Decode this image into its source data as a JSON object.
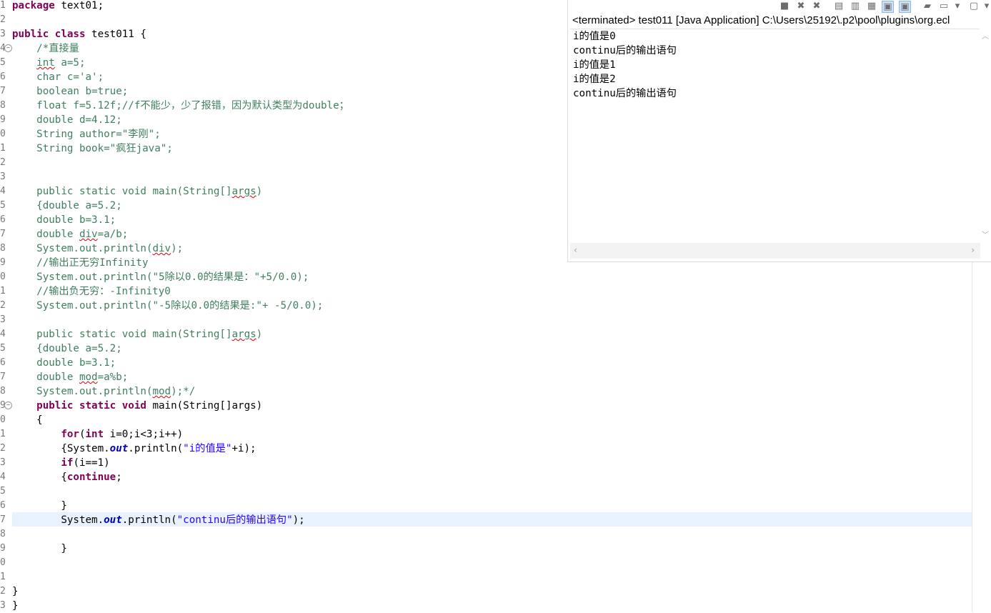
{
  "editor": {
    "line_numbers": [
      "1",
      "2",
      "3",
      "4",
      "5",
      "6",
      "7",
      "8",
      "9",
      "0",
      "1",
      "2",
      "3",
      "4",
      "5",
      "6",
      "7",
      "8",
      "9",
      "0",
      "1",
      "2",
      "3",
      "4",
      "5",
      "6",
      "7",
      "8",
      "9",
      "0",
      "1",
      "2",
      "3",
      "4",
      "5",
      "6",
      "7",
      "8",
      "9",
      "0",
      "1",
      "2",
      "3"
    ],
    "lines": {
      "l1": {
        "a": "package",
        "b": " text01;"
      },
      "l3": {
        "a": "public",
        "b": " ",
        "c": "class",
        "d": " test011 {"
      },
      "l4": "    /*直接量",
      "l5a": "    ",
      "l5b": "int",
      "l5c": " a=5;",
      "l6": "    char c='a';",
      "l7": "    boolean b=true;",
      "l8": "    float f=5.12f;//f不能少，少了报错，因为默认类型为double；",
      "l9": "    double d=4.12;",
      "l10": "    String author=\"李刚\";",
      "l11": "    String book=\"疯狂java\";",
      "l14a": "    public static void main(String[]",
      "l14b": "args",
      "l14c": ")",
      "l15": "    {double a=5.2;",
      "l16": "    double b=3.1;",
      "l17a": "    double ",
      "l17b": "div",
      "l17c": "=a/b;",
      "l18a": "    System.out.println(",
      "l18b": "div",
      "l18c": ");",
      "l19": "    //输出正无穷Infinity",
      "l20": "    System.out.println(\"5除以0.0的结果是：\"+5/0.0);",
      "l21": "    //输出负无穷：-Infinity0",
      "l22": "    System.out.println(\"-5除以0.0的结果是:\"+ -5/0.0);",
      "l24a": "    public static void main(String[]",
      "l24b": "args",
      "l24c": ")",
      "l25": "    {double a=5.2;",
      "l26": "    double b=3.1;",
      "l27a": "    double ",
      "l27b": "mod",
      "l27c": "=a%b;",
      "l28a": "    System.out.println(",
      "l28b": "mod",
      "l28c": ");*/",
      "l29a": "    ",
      "l29b": "public",
      "l29c": " ",
      "l29d": "static",
      "l29e": " ",
      "l29f": "void",
      "l29g": " main(String[]args)",
      "l30": "    {",
      "l31a": "        ",
      "l31b": "for",
      "l31c": "(",
      "l31d": "int",
      "l31e": " i=0;i<3;i++)",
      "l32a": "        {System.",
      "l32b": "out",
      "l32c": ".println(",
      "l32d": "\"i的值是\"",
      "l32e": "+i);",
      "l33a": "        ",
      "l33b": "if",
      "l33c": "(i==1)",
      "l34a": "        {",
      "l34b": "continue",
      "l34c": ";",
      "l36": "        }",
      "l37a": "        System.",
      "l37b": "out",
      "l37c": ".println(",
      "l37d": "\"continu后的输出语句\"",
      "l37e": ");",
      "l39": "        }",
      "l42": "}",
      "l43": "}"
    }
  },
  "console": {
    "title": "<terminated> test011 [Java Application] C:\\Users\\25192\\.p2\\pool\\plugins\\org.ecl",
    "output": [
      "i的值是0",
      "continu后的输出语句",
      "i的值是1",
      "i的值是2",
      "continu后的输出语句"
    ],
    "toolbar_icons": [
      "terminate-icon",
      "remove-launch-icon",
      "remove-all-icon",
      "clear-console-icon",
      "scroll-lock-icon",
      "word-wrap-icon",
      "show-on-stdout-icon",
      "show-on-stderr-icon",
      "pin-console-icon",
      "display-console-icon",
      "view-menu-icon",
      "open-console-icon",
      "open-console-menu-icon"
    ]
  }
}
